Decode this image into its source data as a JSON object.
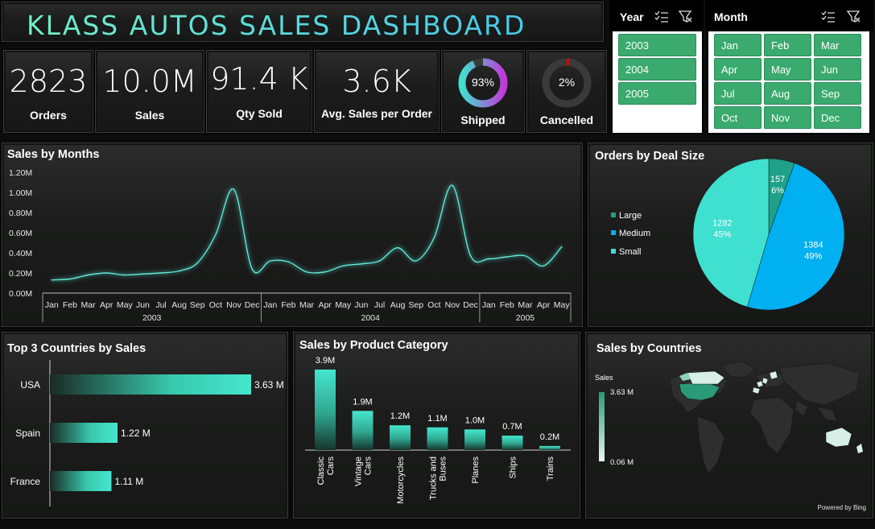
{
  "title": "KLASS AUTOS SALES DASHBOARD",
  "kpis": {
    "orders": {
      "value": "2823",
      "label": "Orders"
    },
    "sales": {
      "value": "10.0M",
      "label": "Sales"
    },
    "qty": {
      "value": "91.4 K",
      "label": "Qty Sold"
    },
    "avg": {
      "value": "3.6K",
      "label": "Avg. Sales per Order"
    },
    "shipped": {
      "value": "93%",
      "label": "Shipped",
      "fraction": 0.93
    },
    "cancelled": {
      "value": "2%",
      "label": "Cancelled",
      "fraction": 0.02
    }
  },
  "year_slicer": {
    "title": "Year",
    "items": [
      "2003",
      "2004",
      "2005"
    ]
  },
  "month_slicer": {
    "title": "Month",
    "items": [
      "Jan",
      "Feb",
      "Mar",
      "Apr",
      "May",
      "Jun",
      "Jul",
      "Aug",
      "Sep",
      "Oct",
      "Nov",
      "Dec"
    ]
  },
  "colors": {
    "accent": "#40e0d0",
    "slicer": "#3aaa6e",
    "medium": "#00b0f0",
    "large": "#1fa088"
  },
  "chart_data": [
    {
      "type": "line",
      "title": "Sales by Months",
      "x": [
        "Jan",
        "Feb",
        "Mar",
        "Apr",
        "May",
        "Jun",
        "Jul",
        "Aug",
        "Sep",
        "Oct",
        "Nov",
        "Dec",
        "Jan",
        "Feb",
        "Mar",
        "Apr",
        "May",
        "Jun",
        "Jul",
        "Aug",
        "Sep",
        "Oct",
        "Nov",
        "Dec",
        "Jan",
        "Feb",
        "Mar",
        "Apr",
        "May"
      ],
      "year_groups": [
        {
          "label": "2003",
          "start": 0,
          "count": 12
        },
        {
          "label": "2004",
          "start": 12,
          "count": 12
        },
        {
          "label": "2005",
          "start": 24,
          "count": 5
        }
      ],
      "values": [
        0.13,
        0.14,
        0.18,
        0.2,
        0.18,
        0.19,
        0.2,
        0.22,
        0.3,
        0.58,
        1.03,
        0.24,
        0.32,
        0.31,
        0.21,
        0.21,
        0.27,
        0.29,
        0.32,
        0.45,
        0.32,
        0.55,
        1.07,
        0.37,
        0.34,
        0.36,
        0.37,
        0.27,
        0.46
      ],
      "yticks": [
        "0.00M",
        "0.20M",
        "0.40M",
        "0.60M",
        "0.80M",
        "1.00M",
        "1.20M"
      ],
      "ylim": [
        0,
        1.2
      ]
    },
    {
      "type": "pie",
      "title": "Orders by Deal Size",
      "slices": [
        {
          "name": "Large",
          "value": 157,
          "label": "157",
          "pct": "6%"
        },
        {
          "name": "Medium",
          "value": 1384,
          "label": "1384",
          "pct": "49%"
        },
        {
          "name": "Small",
          "value": 1282,
          "label": "1282",
          "pct": "45%"
        }
      ]
    },
    {
      "type": "bar",
      "title": "Top 3 Countries by Sales",
      "categories": [
        "USA",
        "Spain",
        "France"
      ],
      "values": [
        3.63,
        1.22,
        1.11
      ],
      "labels": [
        "3.63 M",
        "1.22 M",
        "1.11 M"
      ]
    },
    {
      "type": "bar",
      "title": "Sales by Product Category",
      "categories": [
        [
          "Classic",
          "Cars"
        ],
        [
          "Vintage",
          "Cars"
        ],
        [
          "Motorcycles"
        ],
        [
          "Trucks and",
          "Buses"
        ],
        [
          "Planes"
        ],
        [
          "Ships"
        ],
        [
          "Trains"
        ]
      ],
      "values": [
        3.9,
        1.9,
        1.2,
        1.1,
        1.0,
        0.7,
        0.2
      ],
      "labels": [
        "3.9M",
        "1.9M",
        "1.2M",
        "1.1M",
        "1.0M",
        "0.7M",
        "0.2M"
      ]
    },
    {
      "type": "map",
      "title": "Sales by Countries",
      "legend_title": "Sales",
      "legend_max": "3.63 M",
      "legend_min": "0.06 M",
      "credit": "Powered by Bing"
    }
  ]
}
